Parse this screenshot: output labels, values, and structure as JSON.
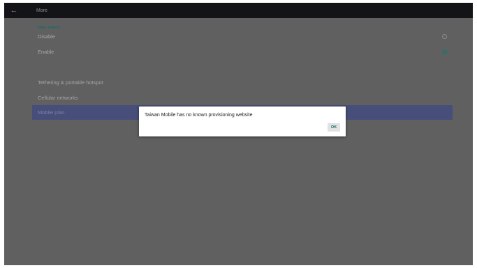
{
  "appbar": {
    "back_icon": "arrow-left-icon",
    "title": "More"
  },
  "main_switch": {
    "header": "Main Switch",
    "options": [
      {
        "label": "Disable",
        "selected": false
      },
      {
        "label": "Enable",
        "selected": true
      }
    ]
  },
  "menu": {
    "items": [
      {
        "label": "Tethering & portable hotspot"
      },
      {
        "label": "Cellular networks"
      },
      {
        "label": "Mobile plan"
      }
    ],
    "selected_index": 2
  },
  "dialog": {
    "message": "Taiwan Mobile has no known provisioning website",
    "ok_label": "OK"
  },
  "colors": {
    "accent": "#1f756e",
    "selection": "#474e7a",
    "appbar": "#131417",
    "dim_background": "#606060"
  }
}
